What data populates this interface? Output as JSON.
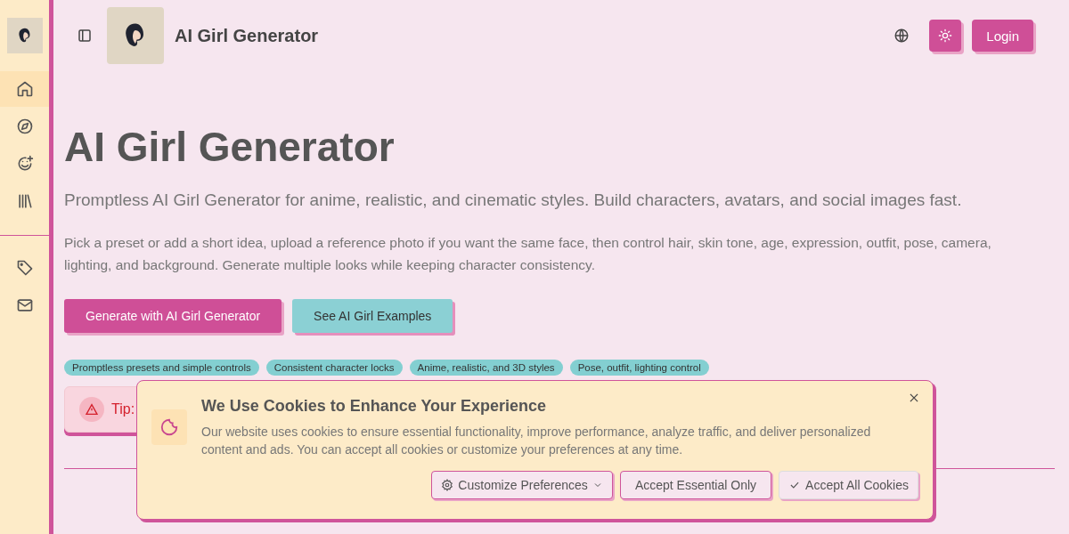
{
  "sidebar": {
    "items": [
      {
        "selected": true
      },
      {
        "selected": false
      },
      {
        "selected": false
      },
      {
        "selected": false
      },
      {
        "selected": false
      },
      {
        "selected": false
      }
    ]
  },
  "header": {
    "title": "AI Girl Generator",
    "login": "Login"
  },
  "hero": {
    "title": "AI Girl Generator",
    "subtitle": "Promptless AI Girl Generator for anime, realistic, and cinematic styles. Build characters, avatars, and social images fast.",
    "description": "Pick a preset or add a short idea, upload a reference photo if you want the same face, then control hair, skin tone, age, expression, outfit, pose, camera, lighting, and background. Generate multiple looks while keeping character consistency.",
    "buttons": [
      {
        "label": "Generate with AI Girl Generator",
        "kind": "primary"
      },
      {
        "label": "See AI Girl Examples",
        "kind": "secondary"
      }
    ],
    "tags": [
      "Promptless presets and simple controls",
      "Consistent character locks",
      "Anime, realistic, and 3D styles",
      "Pose, outfit, lighting control"
    ],
    "tip": {
      "label": "Tip:"
    }
  },
  "cookie_banner": {
    "title": "We Use Cookies to Enhance Your Experience",
    "text": "Our website uses cookies to ensure essential functionality, improve performance, analyze traffic, and deliver personalized content and ads. You can accept all cookies or customize your preferences at any time.",
    "buttons": [
      {
        "label": "Customize Preferences",
        "kind": "customize"
      },
      {
        "label": "Accept Essential Only",
        "kind": "essential"
      },
      {
        "label": "Accept All Cookies",
        "kind": "accept"
      }
    ]
  }
}
